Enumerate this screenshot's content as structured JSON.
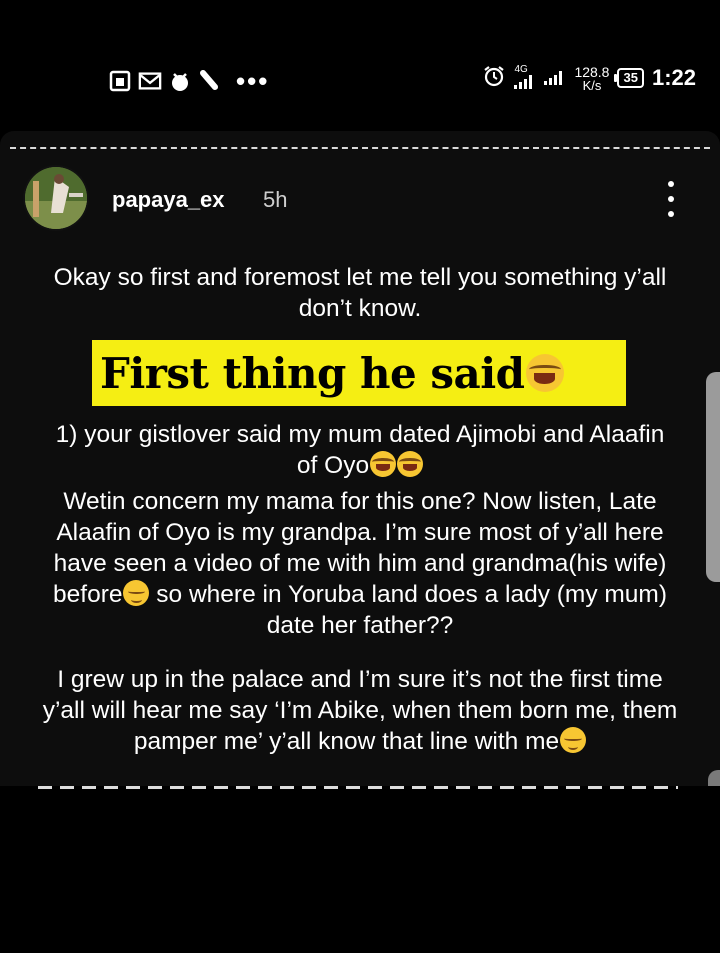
{
  "status_bar": {
    "network": "4G",
    "speed_value": "128.8",
    "speed_unit": "K/s",
    "battery": "35",
    "time": "1:22",
    "icons": [
      "sim-card-icon",
      "mail-icon",
      "bird-icon",
      "broom-icon",
      "more-notifications-icon",
      "alarm-icon",
      "signal-icon",
      "signal-icon-2"
    ]
  },
  "story": {
    "username": "papaya_ex",
    "time_ago": "5h",
    "paragraphs": {
      "intro": "Okay so first and foremost let me tell you something y’all don’t know.",
      "headline": "First thing he said",
      "point1": "1) your gistlover said my mum dated Ajimobi and Alaafin of Oyo",
      "para2": "Wetin concern my mama for this one? Now listen, Late Alaafin of Oyo is my grandpa. I’m sure most of y’all here have seen a video of me with him and grandma(his wife) before",
      "para2_end": " so where in Yoruba land does a lady (my mum) date her father??",
      "para3": "I grew up in the palace and I’m sure it’s not the first time y’all will hear me say ‘I’m Abike, when them born me, them pamper me’ y’all know that line with me"
    }
  },
  "colors": {
    "background": "#000000",
    "card": "#0d0d0d",
    "highlight": "#f5ee13",
    "text": "#ffffff"
  }
}
